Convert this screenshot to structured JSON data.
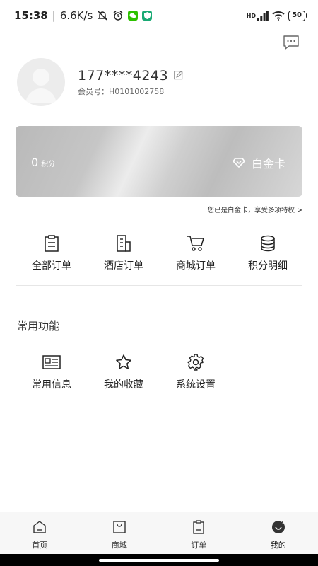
{
  "status_bar": {
    "time": "15:38",
    "separator": "|",
    "speed": "6.6K/s",
    "battery": "50",
    "network": "HD"
  },
  "profile": {
    "phone": "177****4243",
    "member_no": "会员号：H0101002758"
  },
  "card": {
    "points_value": "0",
    "points_unit": "积分",
    "level": "白金卡"
  },
  "privilege_text": "您已是白金卡，享受多项特权 >",
  "orders": [
    {
      "label": "全部订单",
      "icon": "clipboard-icon"
    },
    {
      "label": "酒店订单",
      "icon": "building-icon"
    },
    {
      "label": "商城订单",
      "icon": "cart-icon"
    },
    {
      "label": "积分明细",
      "icon": "coins-icon"
    }
  ],
  "section_title": "常用功能",
  "functions": [
    {
      "label": "常用信息",
      "icon": "id-card-icon"
    },
    {
      "label": "我的收藏",
      "icon": "star-icon"
    },
    {
      "label": "系统设置",
      "icon": "gear-icon"
    }
  ],
  "nav": [
    {
      "label": "首页",
      "icon": "home-icon"
    },
    {
      "label": "商城",
      "icon": "bag-icon"
    },
    {
      "label": "订单",
      "icon": "order-icon"
    },
    {
      "label": "我的",
      "icon": "profile-icon",
      "active": true
    }
  ],
  "colors": {
    "card_start": "#b9b9b9",
    "card_highlight": "#ececec",
    "accent_text": "#ffffff"
  }
}
